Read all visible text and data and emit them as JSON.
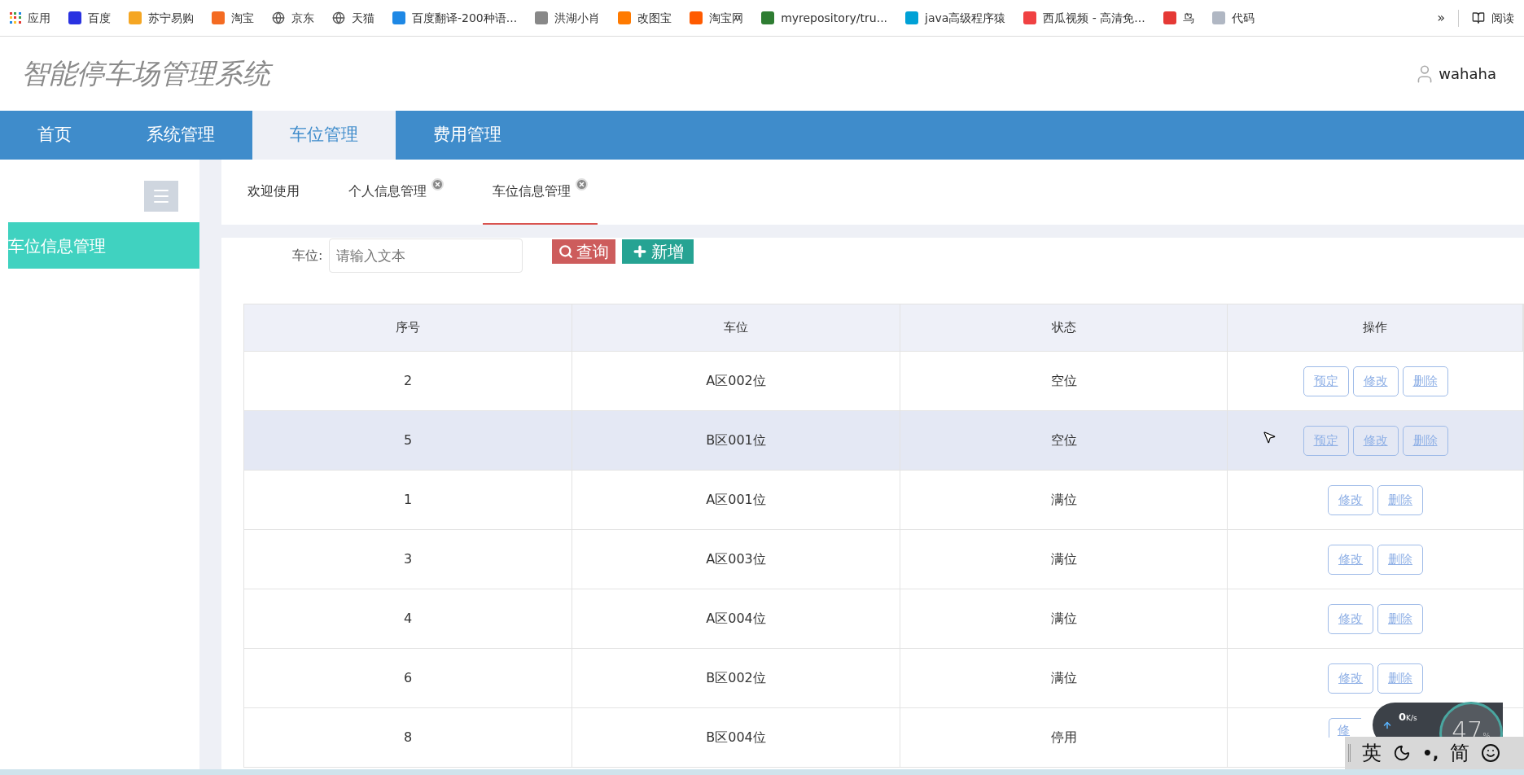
{
  "bookmarks": [
    {
      "label": "应用"
    },
    {
      "label": "百度"
    },
    {
      "label": "苏宁易购"
    },
    {
      "label": "淘宝"
    },
    {
      "label": "京东"
    },
    {
      "label": "天猫"
    },
    {
      "label": "百度翻译-200种语..."
    },
    {
      "label": "洪湖小肖"
    },
    {
      "label": "改图宝"
    },
    {
      "label": "淘宝网"
    },
    {
      "label": "myrepository/tru..."
    },
    {
      "label": "java高级程序猿"
    },
    {
      "label": "西瓜视频 - 高清免..."
    },
    {
      "label": "鸟"
    },
    {
      "label": "代码"
    }
  ],
  "bookmarks_more": "»",
  "reading_mode": "阅读",
  "app_title": "智能停车场管理系统",
  "user": "wahaha",
  "nav": [
    {
      "label": "首页",
      "selected": false
    },
    {
      "label": "系统管理",
      "selected": false
    },
    {
      "label": "车位管理",
      "selected": true
    },
    {
      "label": "费用管理",
      "selected": false
    }
  ],
  "sidebar": {
    "items": [
      {
        "label": "车位信息管理",
        "selected": true
      }
    ]
  },
  "tabs": [
    {
      "label": "欢迎使用",
      "selected": false,
      "closable": false
    },
    {
      "label": "个人信息管理",
      "selected": false,
      "closable": true
    },
    {
      "label": "车位信息管理",
      "selected": true,
      "closable": true
    }
  ],
  "search": {
    "label": "车位:",
    "placeholder": "请输入文本",
    "query_button": "查询",
    "add_button": "新增"
  },
  "table": {
    "columns": [
      "序号",
      "车位",
      "状态",
      "操作"
    ],
    "rows": [
      {
        "cells": [
          "2",
          "A区002位",
          "空位"
        ],
        "actions": [
          "预定",
          "修改",
          "删除"
        ],
        "highlighted": false
      },
      {
        "cells": [
          "5",
          "B区001位",
          "空位"
        ],
        "actions": [
          "预定",
          "修改",
          "删除"
        ],
        "highlighted": true
      },
      {
        "cells": [
          "1",
          "A区001位",
          "满位"
        ],
        "actions": [
          "修改",
          "删除"
        ],
        "highlighted": false
      },
      {
        "cells": [
          "3",
          "A区003位",
          "满位"
        ],
        "actions": [
          "修改",
          "删除"
        ],
        "highlighted": false
      },
      {
        "cells": [
          "4",
          "A区004位",
          "满位"
        ],
        "actions": [
          "修改",
          "删除"
        ],
        "highlighted": false
      },
      {
        "cells": [
          "6",
          "B区002位",
          "满位"
        ],
        "actions": [
          "修改",
          "删除"
        ],
        "highlighted": false
      },
      {
        "cells": [
          "8",
          "B区004位",
          "停用"
        ],
        "actions": [
          "修"
        ],
        "highlighted": false
      }
    ]
  },
  "speed_widget": {
    "upload": "0",
    "unit": "K/s",
    "percent": "47",
    "percent_sign": "%"
  },
  "ime_bar": {
    "mode": "英",
    "punct": "•,",
    "script": "简"
  }
}
